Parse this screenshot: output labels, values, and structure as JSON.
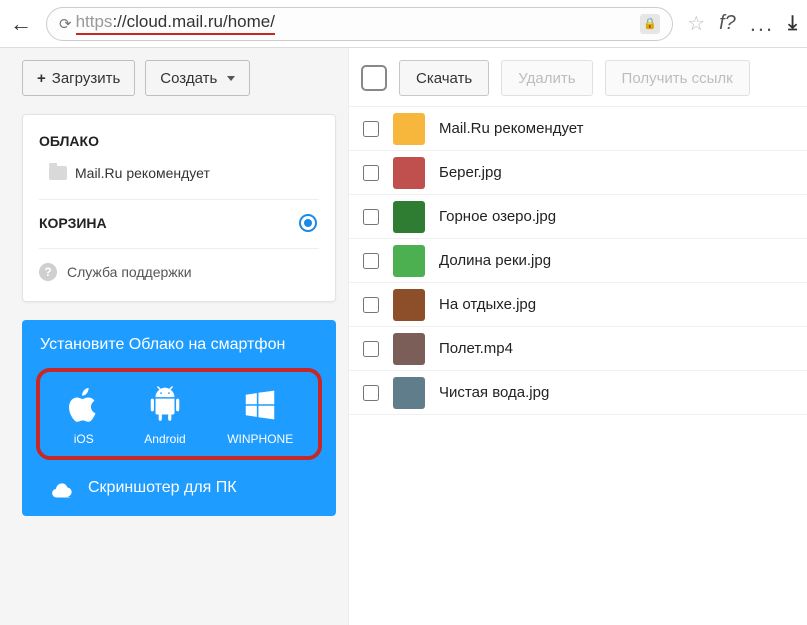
{
  "browser": {
    "url_proto": "https",
    "url_rest": "://cloud.mail.ru/home/",
    "fquestion": "f?",
    "dots": "..."
  },
  "left": {
    "upload": "Загрузить",
    "create": "Создать",
    "cloud_section": "ОБЛАКО",
    "recommend_folder": "Mail.Ru рекомендует",
    "trash_section": "КОРЗИНА",
    "support": "Служба поддержки"
  },
  "promo": {
    "title": "Установите Облако на смартфон",
    "ios": "iOS",
    "android": "Android",
    "winphone": "WINPHONE",
    "screenshoter": "Скриншотер для ПК"
  },
  "toolbar": {
    "download": "Скачать",
    "delete": "Удалить",
    "getlink": "Получить ссылк"
  },
  "files": [
    {
      "name": "Mail.Ru рекомендует",
      "color": "#f6b73c"
    },
    {
      "name": "Берег.jpg",
      "color": "#c0504d"
    },
    {
      "name": "Горное озеро.jpg",
      "color": "#2e7d32"
    },
    {
      "name": "Долина реки.jpg",
      "color": "#4caf50"
    },
    {
      "name": "На отдыхе.jpg",
      "color": "#8d4e2a"
    },
    {
      "name": "Полет.mp4",
      "color": "#7b5e57"
    },
    {
      "name": "Чистая вода.jpg",
      "color": "#607d8b"
    }
  ]
}
